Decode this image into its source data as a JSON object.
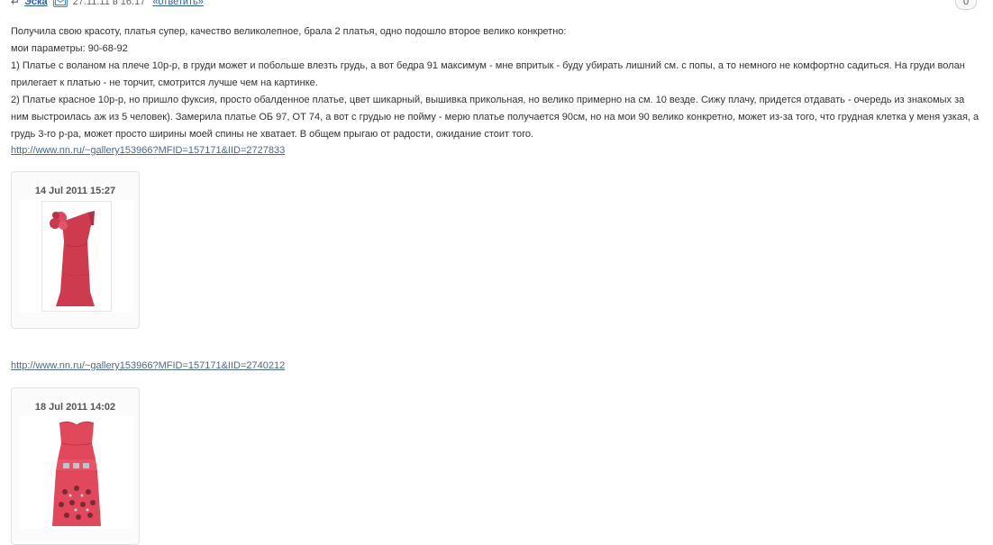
{
  "comment": {
    "author": "Эска",
    "date": "27.11.11 в 16:17",
    "reply_label": "«ответить»",
    "rating": "0",
    "paragraphs": [
      "Получила свою красоту, платья супер, качество великолепное, брала 2 платья, одно подошло второе велико конкретно:",
      "мои параметры: 90-68-92",
      "1) Платье с воланом на плече 10р-р, в груди может и побольше влезть грудь, а вот бедра 91 максимум - мне впритык - буду убирать лишний см. с попы, а то немного не комфортно садиться. На груди волан прилегает к платью - не торчит, смотрится лучше чем на картинке.",
      "2) Платье красное 10р-р, но пришло фуксия, просто обалденное платье, цвет шикарный, вышивка прикольная, но велико примерно на см. 10 везде. Сижу плачу, придется отдавать - очередь из знакомых за ним выстроилась аж из 5 человек). Замерила платье ОБ 97, ОТ 74, а вот с грудью не пойму - мерю платье получается 90см, но на мои 90 велико конкретно, может из-за того, что грудная клетка у меня узкая, а грудь 3-го р-ра, может просто ширины моей спины не хватает. В общем прыгаю от радости, ожидание стоит того."
    ],
    "attachments": [
      {
        "link": "http://www.nn.ru/~gallery153966?MFID=157171&IID=2727833",
        "date": "14 Jul 2011 15:27",
        "image_desc": "one-shoulder-red-dress-with-ruffle"
      },
      {
        "link": "http://www.nn.ru/~gallery153966?MFID=157171&IID=2740212",
        "date": "18 Jul 2011 14:02",
        "image_desc": "strapless-fuchsia-dress-with-embroidery"
      }
    ]
  },
  "colors": {
    "link": "#2a5db0",
    "dress_red": "#cf3b4e",
    "dress_fuchsia": "#e2485c"
  }
}
